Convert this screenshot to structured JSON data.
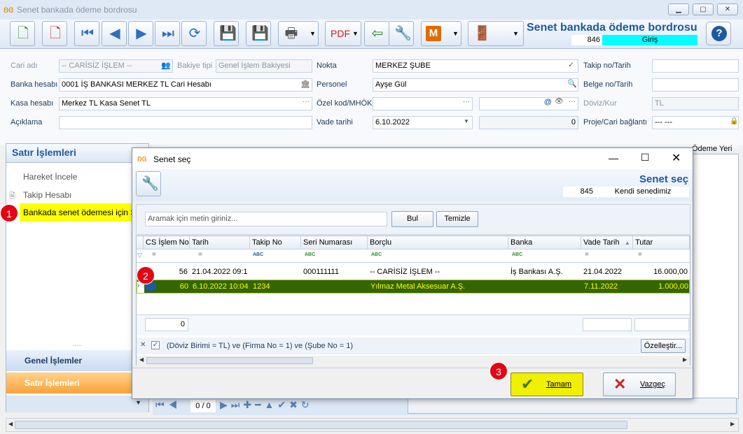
{
  "window": {
    "title": "Senet bankada ödeme bordrosu",
    "min": "▁",
    "max": "▢",
    "close": "✕"
  },
  "header": {
    "title": "Senet bankada ödeme bordrosu",
    "number": "846",
    "status": "Giriş"
  },
  "form": {
    "cari_adi_label": "Cari adı",
    "cari_adi": "-- CARİSİZ İŞLEM --",
    "bakiye_tipi_label": "Bakiye tipi",
    "bakiye_tipi": "Genel İşlem Bakiyesi",
    "banka_hesabi_label": "Banka hesabı",
    "banka_hesabi": "0001 İŞ BANKASI MERKEZ TL Cari Hesabı",
    "kasa_hesabi_label": "Kasa hesabı",
    "kasa_hesabi": "Merkez TL Kasa Senet TL",
    "aciklama_label": "Açıklama",
    "aciklama": "",
    "nokta_label": "Nokta",
    "nokta": "MERKEZ ŞUBE",
    "personel_label": "Personel",
    "personel": "Ayşe Gül",
    "ozel_kod_label": "Özel kod/MHÖK",
    "ozel_kod": "",
    "ozel_kod2": "",
    "vade_tarihi_label": "Vade tarihi",
    "vade_tarihi": "6.10.2022",
    "vade_gun": "0",
    "takip_no_label": "Takip no/Tarih",
    "belge_no_label": "Belge no/Tarih",
    "doviz_kur_label": "Döviz/Kur",
    "doviz": "TL",
    "proje_label": "Proje/Cari bağlantı",
    "proje": "--- ---"
  },
  "nav": {
    "header": "Satır İşlemleri",
    "items": [
      "Hareket İncele",
      "Takip Hesabı",
      "Bankada senet ödemesi için S"
    ],
    "groups": [
      "Genel İşlemler",
      "Satır İşlemleri"
    ],
    "pager": "0 / 0",
    "behind_col": "Ödeme Yeri"
  },
  "dialog": {
    "title": "Senet seç",
    "header_title": "Senet seç",
    "number": "845",
    "type": "Kendi senedimiz",
    "search_placeholder": "Aramak için metin giriniz...",
    "find_button": "Bul",
    "clear_button": "Temizle",
    "columns": [
      "CS İşlem No",
      "Tarih",
      "Takip No",
      "Seri Numarası",
      "Borçlu",
      "Banka",
      "Vade Tarih",
      "Tutar"
    ],
    "rows": [
      [
        "56",
        "21.04.2022 09:1",
        "",
        "000111111",
        "-- CARİSİZ İŞLEM --",
        "İş Bankası A.Ş.",
        "21.04.2022",
        "16.000,00"
      ],
      [
        "60",
        "6.10.2022 10:04",
        "1234",
        "",
        "Yılmaz Metal Aksesuar A.Ş.",
        "",
        "7.11.2022",
        "1.000,00"
      ]
    ],
    "footer_count": "0",
    "filter_text": "(Döviz Birimi = TL) ve (Firma No = 1) ve (Şube No = 1)",
    "customize_button": "Özelleştir...",
    "ok_button": "Tamam",
    "cancel_button": "Vazgeç"
  },
  "badges": [
    "1",
    "2",
    "3"
  ],
  "colors": {
    "accent": "#1e5aa0",
    "status_bg": "#00ffff",
    "selected_row": "#336600",
    "selected_text": "#ffff00",
    "highlight": "#ffff00",
    "badge": "#e30613",
    "ok_button": "#f0f000"
  }
}
